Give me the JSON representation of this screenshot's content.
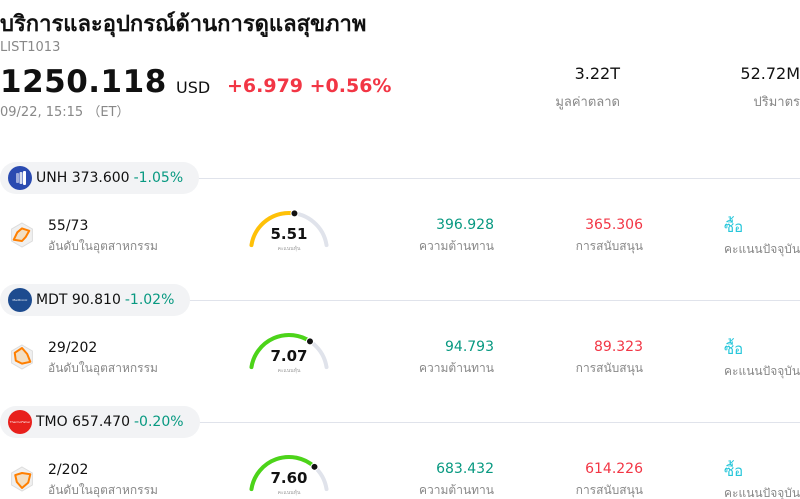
{
  "header": {
    "title": "บริการและอุปกรณ์ด้านการดูแลสุขภาพ",
    "code": "LIST1013",
    "price": "1250.118",
    "currency": "USD",
    "change": "+6.979 +0.56%",
    "time": "09/22, 15:15 （ET）"
  },
  "stats": {
    "market_cap": {
      "value": "3.22T",
      "label": "มูลค่าตลาด"
    },
    "volume": {
      "value": "52.72M",
      "label": "ปริมาตร"
    }
  },
  "items": [
    {
      "symbol": "UNH 373.600",
      "change_pct": "-1.05%",
      "logo": {
        "color": "#2a4bb1",
        "icon": "unh-logo"
      },
      "rank": "55/73",
      "rank_label": "อันดับในอุตสาหกรรม",
      "score": "5.51",
      "score_level": 0.551,
      "score_color": "#ffc107",
      "score_label": "คะแนนหุ้น",
      "resistance": "396.928",
      "resistance_label": "ความต้านทาน",
      "support": "365.306",
      "support_label": "การสนับสนุน",
      "action": "ซื้อ",
      "action_label": "คะแนนปัจจุบัน"
    },
    {
      "symbol": "MDT 90.810",
      "change_pct": "-1.02%",
      "logo": {
        "color": "#1d4b8f",
        "icon": "medtronic-logo",
        "text": "Medtronic"
      },
      "rank": "29/202",
      "rank_label": "อันดับในอุตสาหกรรม",
      "score": "7.07",
      "score_level": 0.707,
      "score_color": "#4cd419",
      "score_label": "คะแนนหุ้น",
      "resistance": "94.793",
      "resistance_label": "ความต้านทาน",
      "support": "89.323",
      "support_label": "การสนับสนุน",
      "action": "ซื้อ",
      "action_label": "คะแนนปัจจุบัน"
    },
    {
      "symbol": "TMO 657.470",
      "change_pct": "-0.20%",
      "logo": {
        "color": "#e8201c",
        "icon": "thermo-fisher-logo",
        "text": "ThermoFisher"
      },
      "rank": "2/202",
      "rank_label": "อันดับในอุตสาหกรรม",
      "score": "7.60",
      "score_level": 0.76,
      "score_color": "#4cd419",
      "score_label": "คะแนนหุ้น",
      "resistance": "683.432",
      "resistance_label": "ความต้านทาน",
      "support": "614.226",
      "support_label": "การสนับสนุน",
      "action": "ซื้อ",
      "action_label": "คะแนนปัจจุบัน"
    }
  ]
}
